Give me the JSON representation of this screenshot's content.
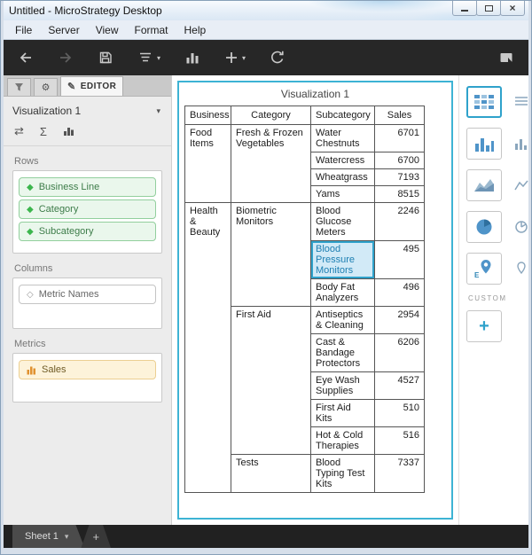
{
  "window": {
    "title": "Untitled - MicroStrategy Desktop"
  },
  "icons": {
    "caret_down": "▾",
    "gear": "⚙",
    "pencil": "✎",
    "sigma": "Σ",
    "swap": "⇄",
    "diamond": "◆",
    "diamond_outline": "◇",
    "close": "×",
    "plus": "+"
  },
  "menu": {
    "items": [
      "File",
      "Server",
      "View",
      "Format",
      "Help"
    ]
  },
  "editor": {
    "tab_label": "EDITOR",
    "visualization_name": "Visualization 1",
    "rows_label": "Rows",
    "rows": [
      "Business Line",
      "Category",
      "Subcategory"
    ],
    "columns_label": "Columns",
    "columns": [
      "Metric Names"
    ],
    "metrics_label": "Metrics",
    "metrics": [
      "Sales"
    ]
  },
  "viz": {
    "title": "Visualization 1",
    "headers": [
      "Business L",
      "Category",
      "Subcategory",
      "Sales"
    ],
    "rows": [
      {
        "cells": [
          {
            "t": "Food Items",
            "rs": 4
          },
          {
            "t": "Fresh & Frozen Vegetables",
            "rs": 4
          },
          {
            "t": "Water Chestnuts"
          },
          {
            "t": "6701",
            "num": true
          }
        ]
      },
      {
        "cells": [
          {
            "t": "Watercress"
          },
          {
            "t": "6700",
            "num": true
          }
        ]
      },
      {
        "cells": [
          {
            "t": "Wheatgrass"
          },
          {
            "t": "7193",
            "num": true
          }
        ]
      },
      {
        "cells": [
          {
            "t": "Yams"
          },
          {
            "t": "8515",
            "num": true
          }
        ]
      },
      {
        "cells": [
          {
            "t": "Health & Beauty",
            "rs": 9
          },
          {
            "t": "Biometric Monitors",
            "rs": 3
          },
          {
            "t": "Blood Glucose Meters"
          },
          {
            "t": "2246",
            "num": true
          }
        ]
      },
      {
        "cells": [
          {
            "t": "Blood Pressure Monitors",
            "selected": true
          },
          {
            "t": "495",
            "num": true
          }
        ]
      },
      {
        "cells": [
          {
            "t": "Body Fat Analyzers"
          },
          {
            "t": "496",
            "num": true
          }
        ]
      },
      {
        "cells": [
          {
            "t": "First Aid",
            "rs": 5
          },
          {
            "t": "Antiseptics & Cleaning"
          },
          {
            "t": "2954",
            "num": true
          }
        ]
      },
      {
        "cells": [
          {
            "t": "Cast & Bandage Protectors"
          },
          {
            "t": "6206",
            "num": true
          }
        ]
      },
      {
        "cells": [
          {
            "t": "Eye Wash Supplies"
          },
          {
            "t": "4527",
            "num": true
          }
        ]
      },
      {
        "cells": [
          {
            "t": "First Aid Kits"
          },
          {
            "t": "510",
            "num": true
          }
        ]
      },
      {
        "cells": [
          {
            "t": "Hot & Cold Therapies"
          },
          {
            "t": "516",
            "num": true
          }
        ]
      },
      {
        "cells": [
          {
            "t": "Tests"
          },
          {
            "t": "Blood Typing Test Kits"
          },
          {
            "t": "7337",
            "num": true
          }
        ]
      }
    ]
  },
  "gallery": {
    "custom_label": "CUSTOM"
  },
  "sheetbar": {
    "sheet_label": "Sheet 1",
    "add_label": "+"
  }
}
